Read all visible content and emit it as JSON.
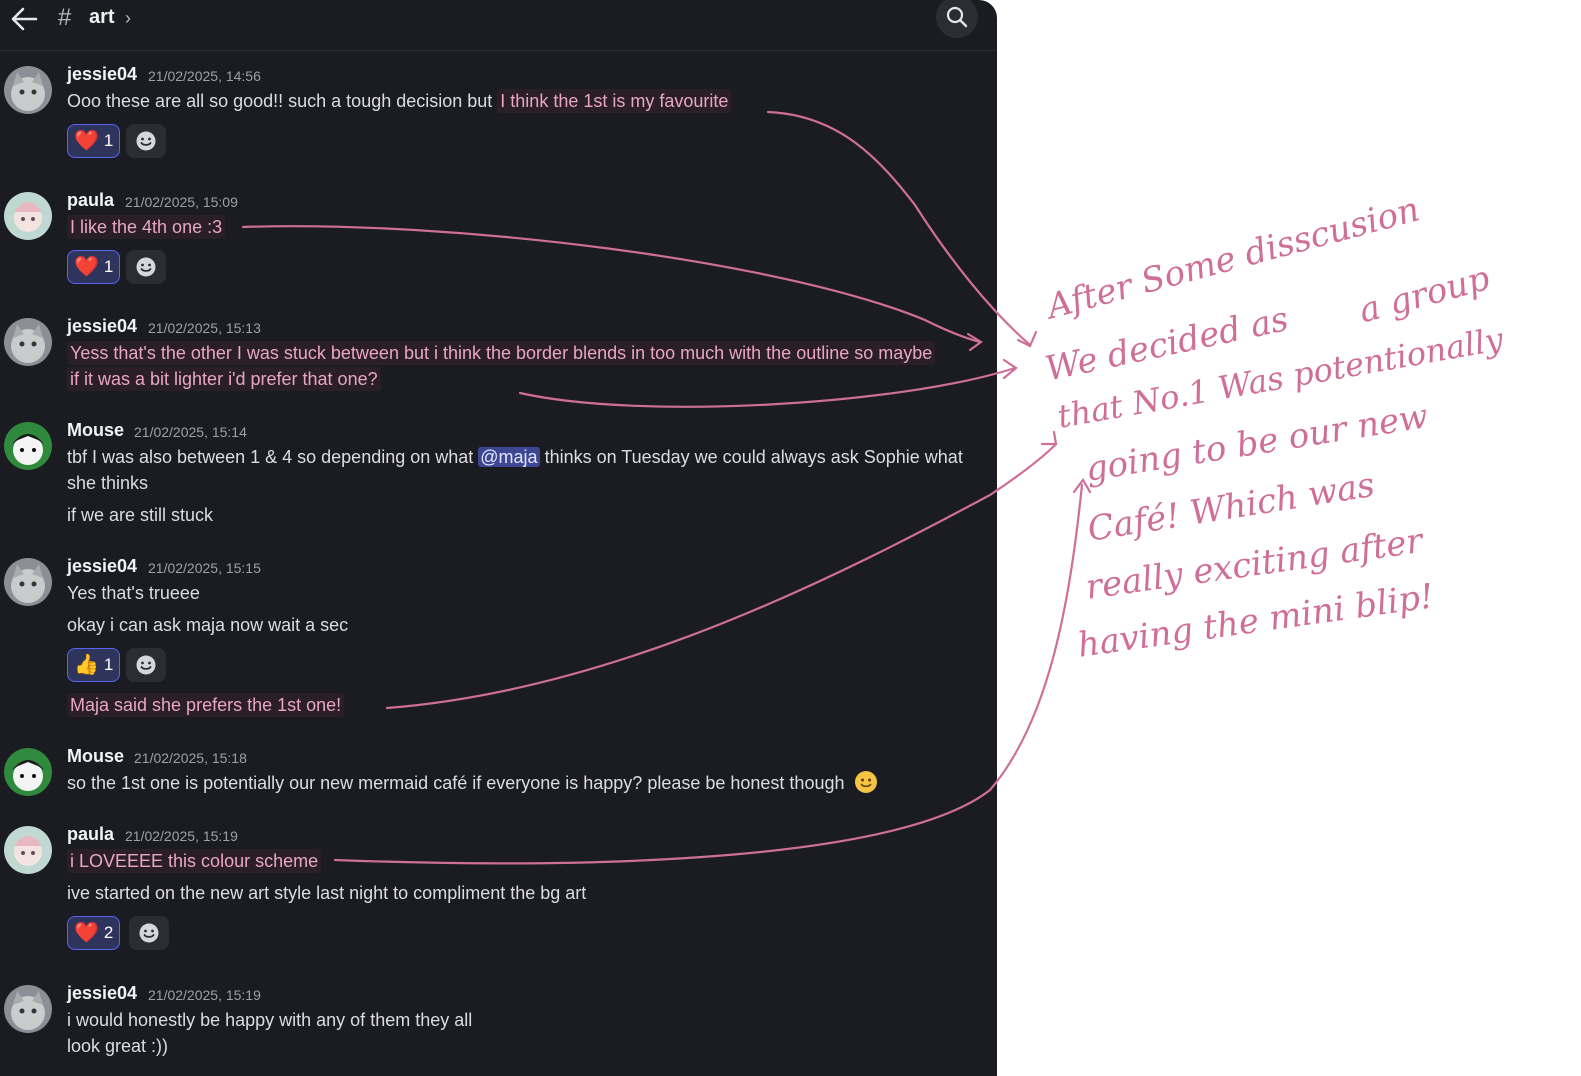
{
  "header": {
    "channel_name": "art",
    "hash": "#",
    "chevron": "›"
  },
  "icons": {
    "back": "arrow-left-icon",
    "search": "search-icon",
    "add_reaction": "smiley-icon"
  },
  "colors": {
    "bg": "#1b1c22",
    "highlight": "#e9a6c5",
    "annotation": "#cf6f98",
    "mention": "#3c4692",
    "reaction_border": "#5865f2"
  },
  "messages": [
    {
      "author": "jessie04",
      "timestamp": "21/02/2025, 14:56",
      "text_pre": "Ooo these are all so good!! such a tough decision but ",
      "text_hl": "I think the 1st is my favourite",
      "reaction": {
        "emoji": "❤️",
        "count": "1"
      }
    },
    {
      "author": "paula",
      "timestamp": "21/02/2025, 15:09",
      "text_hl": "I like the 4th one :3",
      "reaction": {
        "emoji": "❤️",
        "count": "1"
      }
    },
    {
      "author": "jessie04",
      "timestamp": "21/02/2025, 15:13",
      "text_line1": "Yess that's the other I was stuck between but i think the border blends in too much with the outline so maybe",
      "text_line2": "if it was a bit lighter i'd prefer that one?"
    },
    {
      "author": "Mouse",
      "timestamp": "21/02/2025, 15:14",
      "text_pre": "tbf I was also between 1 & 4 so depending on what ",
      "mention": "@maja",
      "text_post": " thinks on Tuesday we could always ask Sophie what",
      "text_line2": "she thinks",
      "text_line3": "if we are still stuck"
    },
    {
      "author": "jessie04",
      "timestamp": "21/02/2025, 15:15",
      "text_line1": "Yes that's trueee",
      "text_line2": "okay i can ask maja now wait a sec",
      "reaction": {
        "emoji": "👍",
        "count": "1"
      },
      "text_line3": "Maja said she prefers the 1st one!"
    },
    {
      "author": "Mouse",
      "timestamp": "21/02/2025, 15:18",
      "text_line1": "so the 1st one is potentially our new mermaid café if everyone is happy? please be honest though"
    },
    {
      "author": "paula",
      "timestamp": "21/02/2025, 15:19",
      "text_line1": "i LOVEEEE this colour scheme",
      "text_line2": "ive started on the new art style last night to compliment the bg art",
      "reaction": {
        "emoji": "❤️",
        "count": "2"
      }
    },
    {
      "author": "jessie04",
      "timestamp": "21/02/2025, 15:19",
      "text_line1": "i would honestly be happy with any of them they all",
      "text_line2": "look great :))"
    }
  ],
  "annotation": {
    "lines": [
      "After Some disscusion",
      "a group",
      "We decided as",
      "that No.1 Was potentionally",
      "going to be our new",
      "Café! Which was",
      "really exciting after",
      "having the mini blip!"
    ]
  }
}
